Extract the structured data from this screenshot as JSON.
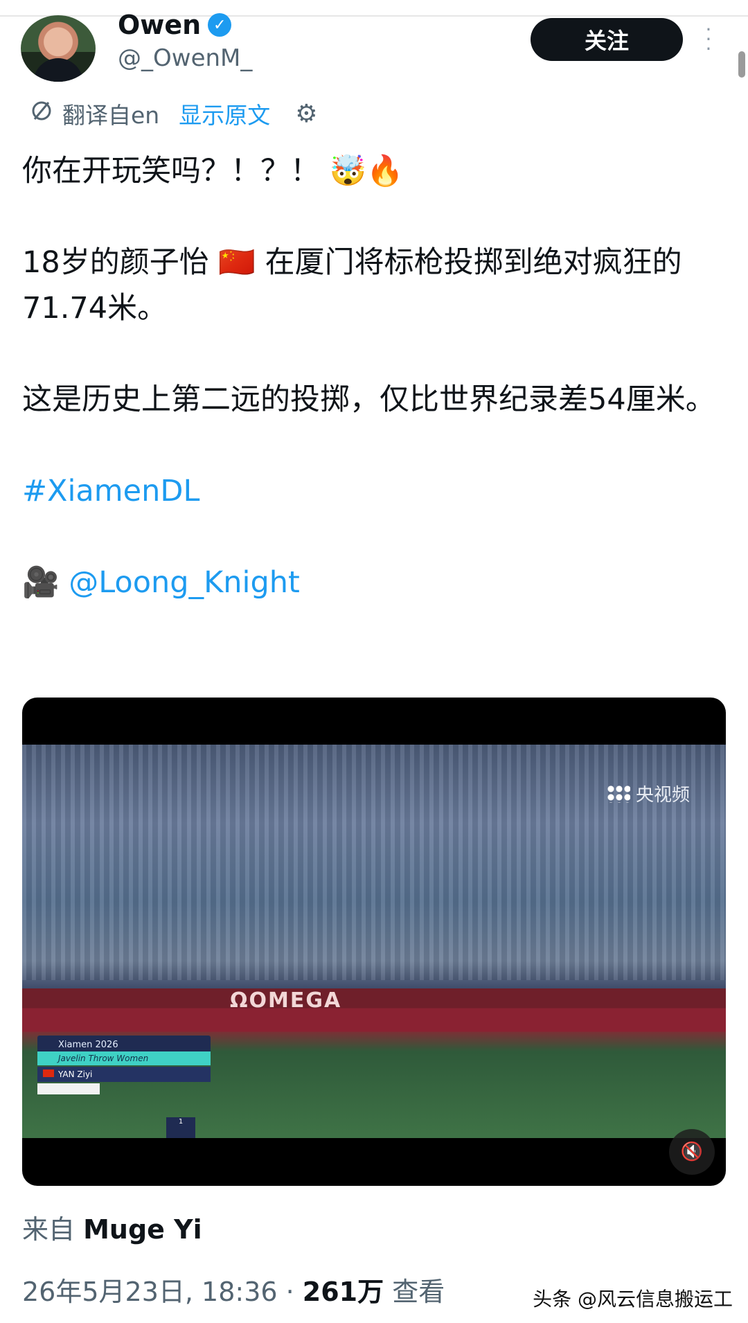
{
  "author": {
    "name": "Owen",
    "handle": "@_OwenM_",
    "verified_icon": "verified-check-icon"
  },
  "actions": {
    "follow_label": "关注",
    "more_icon": "more-vertical-icon"
  },
  "translation": {
    "label": "翻译自en",
    "show_original": "显示原文",
    "icon": "translate-icon",
    "settings_icon": "gear-icon"
  },
  "tweet": {
    "line1": "你在开玩笑吗？！？！ 🤯🔥",
    "para2_a": "18岁的颜子怡 ",
    "para2_flag": "🇨🇳",
    "para2_b": " 在厦门将标枪投掷到绝对疯狂的71.74米。",
    "para3": "这是历史上第二远的投掷，仅比世界纪录差54厘米。",
    "hashtag": "#XiamenDL",
    "camera_emoji": "🎥",
    "mention": "@Loong_Knight"
  },
  "video": {
    "watermark": "央视频",
    "sponsor_text": "ΩOMEGA",
    "overlay_event": "Xiamen 2026",
    "overlay_sub": "Javelin Throw Women",
    "overlay_athlete": "YAN Ziyi",
    "overlay_rank": "1",
    "mute_icon": "volume-mute-icon"
  },
  "footer": {
    "source_prefix": "来自 ",
    "source_name": "Muge Yi",
    "datetime": "26年5月23日, 18:36 · ",
    "views": "261万",
    "views_label": " 查看",
    "credit": "头条 @风云信息搬运工"
  }
}
